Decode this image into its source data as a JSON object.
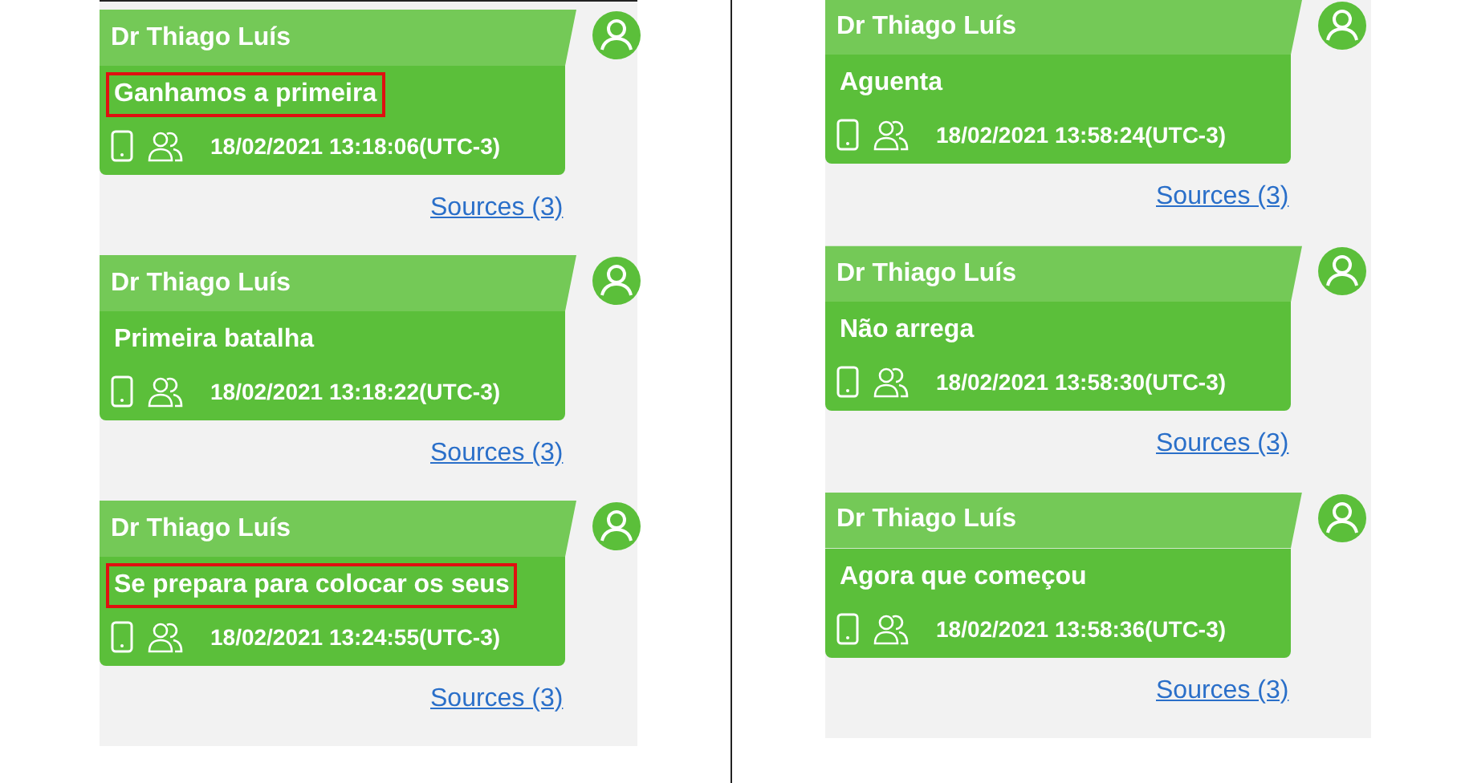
{
  "columns": [
    {
      "messages": [
        {
          "sender": "Dr Thiago Luís",
          "text": "Ganhamos a primeira",
          "highlighted": true,
          "timestamp": "18/02/2021 13:18:06(UTC-3)",
          "sources": "Sources (3)"
        },
        {
          "sender": "Dr Thiago Luís",
          "text": "Primeira batalha",
          "highlighted": false,
          "timestamp": "18/02/2021 13:18:22(UTC-3)",
          "sources": "Sources (3)"
        },
        {
          "sender": "Dr Thiago Luís",
          "text": "Se prepara para colocar os seus",
          "highlighted": true,
          "timestamp": "18/02/2021 13:24:55(UTC-3)",
          "sources": "Sources (3)"
        }
      ]
    },
    {
      "messages": [
        {
          "sender": "Dr Thiago Luís",
          "text": "Aguenta",
          "highlighted": false,
          "timestamp": "18/02/2021 13:58:24(UTC-3)",
          "sources": "Sources (3)"
        },
        {
          "sender": "Dr Thiago Luís",
          "text": "Não arrega",
          "highlighted": false,
          "timestamp": "18/02/2021 13:58:30(UTC-3)",
          "sources": "Sources (3)"
        },
        {
          "sender": "Dr Thiago Luís",
          "text": "Agora que começou",
          "highlighted": false,
          "timestamp": "18/02/2021 13:58:36(UTC-3)",
          "sources": "Sources (3)"
        }
      ]
    }
  ]
}
